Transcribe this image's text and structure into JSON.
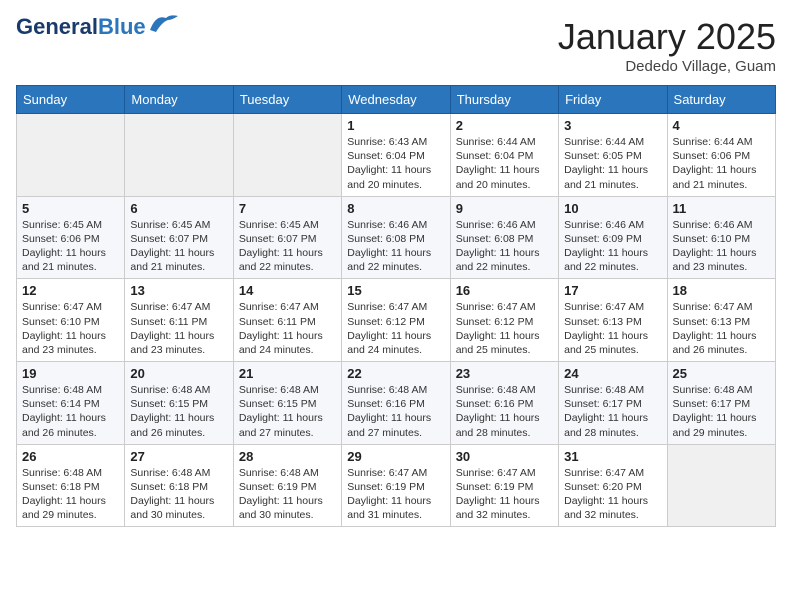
{
  "header": {
    "logo_line1": "General",
    "logo_line2": "Blue",
    "month": "January 2025",
    "location": "Dededo Village, Guam"
  },
  "weekdays": [
    "Sunday",
    "Monday",
    "Tuesday",
    "Wednesday",
    "Thursday",
    "Friday",
    "Saturday"
  ],
  "weeks": [
    [
      {
        "day": "",
        "info": ""
      },
      {
        "day": "",
        "info": ""
      },
      {
        "day": "",
        "info": ""
      },
      {
        "day": "1",
        "info": "Sunrise: 6:43 AM\nSunset: 6:04 PM\nDaylight: 11 hours and 20 minutes."
      },
      {
        "day": "2",
        "info": "Sunrise: 6:44 AM\nSunset: 6:04 PM\nDaylight: 11 hours and 20 minutes."
      },
      {
        "day": "3",
        "info": "Sunrise: 6:44 AM\nSunset: 6:05 PM\nDaylight: 11 hours and 21 minutes."
      },
      {
        "day": "4",
        "info": "Sunrise: 6:44 AM\nSunset: 6:06 PM\nDaylight: 11 hours and 21 minutes."
      }
    ],
    [
      {
        "day": "5",
        "info": "Sunrise: 6:45 AM\nSunset: 6:06 PM\nDaylight: 11 hours and 21 minutes."
      },
      {
        "day": "6",
        "info": "Sunrise: 6:45 AM\nSunset: 6:07 PM\nDaylight: 11 hours and 21 minutes."
      },
      {
        "day": "7",
        "info": "Sunrise: 6:45 AM\nSunset: 6:07 PM\nDaylight: 11 hours and 22 minutes."
      },
      {
        "day": "8",
        "info": "Sunrise: 6:46 AM\nSunset: 6:08 PM\nDaylight: 11 hours and 22 minutes."
      },
      {
        "day": "9",
        "info": "Sunrise: 6:46 AM\nSunset: 6:08 PM\nDaylight: 11 hours and 22 minutes."
      },
      {
        "day": "10",
        "info": "Sunrise: 6:46 AM\nSunset: 6:09 PM\nDaylight: 11 hours and 22 minutes."
      },
      {
        "day": "11",
        "info": "Sunrise: 6:46 AM\nSunset: 6:10 PM\nDaylight: 11 hours and 23 minutes."
      }
    ],
    [
      {
        "day": "12",
        "info": "Sunrise: 6:47 AM\nSunset: 6:10 PM\nDaylight: 11 hours and 23 minutes."
      },
      {
        "day": "13",
        "info": "Sunrise: 6:47 AM\nSunset: 6:11 PM\nDaylight: 11 hours and 23 minutes."
      },
      {
        "day": "14",
        "info": "Sunrise: 6:47 AM\nSunset: 6:11 PM\nDaylight: 11 hours and 24 minutes."
      },
      {
        "day": "15",
        "info": "Sunrise: 6:47 AM\nSunset: 6:12 PM\nDaylight: 11 hours and 24 minutes."
      },
      {
        "day": "16",
        "info": "Sunrise: 6:47 AM\nSunset: 6:12 PM\nDaylight: 11 hours and 25 minutes."
      },
      {
        "day": "17",
        "info": "Sunrise: 6:47 AM\nSunset: 6:13 PM\nDaylight: 11 hours and 25 minutes."
      },
      {
        "day": "18",
        "info": "Sunrise: 6:47 AM\nSunset: 6:13 PM\nDaylight: 11 hours and 26 minutes."
      }
    ],
    [
      {
        "day": "19",
        "info": "Sunrise: 6:48 AM\nSunset: 6:14 PM\nDaylight: 11 hours and 26 minutes."
      },
      {
        "day": "20",
        "info": "Sunrise: 6:48 AM\nSunset: 6:15 PM\nDaylight: 11 hours and 26 minutes."
      },
      {
        "day": "21",
        "info": "Sunrise: 6:48 AM\nSunset: 6:15 PM\nDaylight: 11 hours and 27 minutes."
      },
      {
        "day": "22",
        "info": "Sunrise: 6:48 AM\nSunset: 6:16 PM\nDaylight: 11 hours and 27 minutes."
      },
      {
        "day": "23",
        "info": "Sunrise: 6:48 AM\nSunset: 6:16 PM\nDaylight: 11 hours and 28 minutes."
      },
      {
        "day": "24",
        "info": "Sunrise: 6:48 AM\nSunset: 6:17 PM\nDaylight: 11 hours and 28 minutes."
      },
      {
        "day": "25",
        "info": "Sunrise: 6:48 AM\nSunset: 6:17 PM\nDaylight: 11 hours and 29 minutes."
      }
    ],
    [
      {
        "day": "26",
        "info": "Sunrise: 6:48 AM\nSunset: 6:18 PM\nDaylight: 11 hours and 29 minutes."
      },
      {
        "day": "27",
        "info": "Sunrise: 6:48 AM\nSunset: 6:18 PM\nDaylight: 11 hours and 30 minutes."
      },
      {
        "day": "28",
        "info": "Sunrise: 6:48 AM\nSunset: 6:19 PM\nDaylight: 11 hours and 30 minutes."
      },
      {
        "day": "29",
        "info": "Sunrise: 6:47 AM\nSunset: 6:19 PM\nDaylight: 11 hours and 31 minutes."
      },
      {
        "day": "30",
        "info": "Sunrise: 6:47 AM\nSunset: 6:19 PM\nDaylight: 11 hours and 32 minutes."
      },
      {
        "day": "31",
        "info": "Sunrise: 6:47 AM\nSunset: 6:20 PM\nDaylight: 11 hours and 32 minutes."
      },
      {
        "day": "",
        "info": ""
      }
    ]
  ]
}
